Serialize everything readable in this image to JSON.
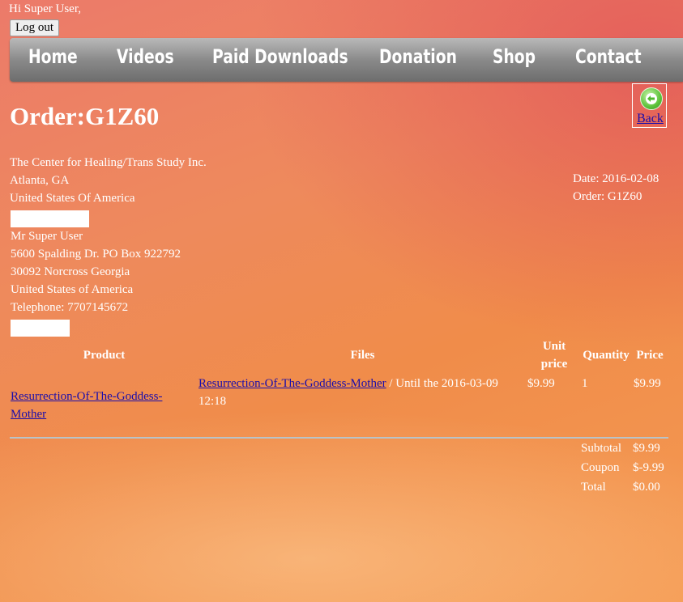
{
  "header": {
    "greeting": "Hi Super User,",
    "logout_label": "Log out"
  },
  "nav": {
    "items": [
      "Home",
      "Videos",
      "Paid Downloads",
      "Donation",
      "Shop",
      "Contact"
    ]
  },
  "order": {
    "title": "Order:G1Z60",
    "back_label": "Back",
    "date_line": "Date: 2016-02-08",
    "order_line": "Order: G1Z60"
  },
  "seller": {
    "name": "The Center for Healing/Trans Study Inc.",
    "city": "Atlanta, GA",
    "country": "United States Of America"
  },
  "buyer": {
    "name": "Mr Super User",
    "street": "5600 Spalding Dr. PO Box 922792",
    "city": "30092 Norcross Georgia",
    "country": "United States of America",
    "phone": "Telephone: 7707145672"
  },
  "table": {
    "headers": {
      "product": "Product",
      "files": "Files",
      "unit_price_1": "Unit",
      "unit_price_2": "price",
      "quantity": "Quantity",
      "price": "Price"
    },
    "rows": [
      {
        "product_1": "Resurrection-Of-The-Goddess-",
        "product_2": "Mother",
        "file_link": "Resurrection-Of-The-Goddess-Mother",
        "file_until_1": " / Until the 2016-03-09",
        "file_until_2": "12:18",
        "unit_price": "$9.99",
        "quantity": "1",
        "price": "$9.99"
      }
    ]
  },
  "totals": {
    "subtotal_label": "Subtotal",
    "subtotal_value": "$9.99",
    "coupon_label": "Coupon",
    "coupon_value": "$-9.99",
    "total_label": "Total",
    "total_value": "$0.00"
  }
}
